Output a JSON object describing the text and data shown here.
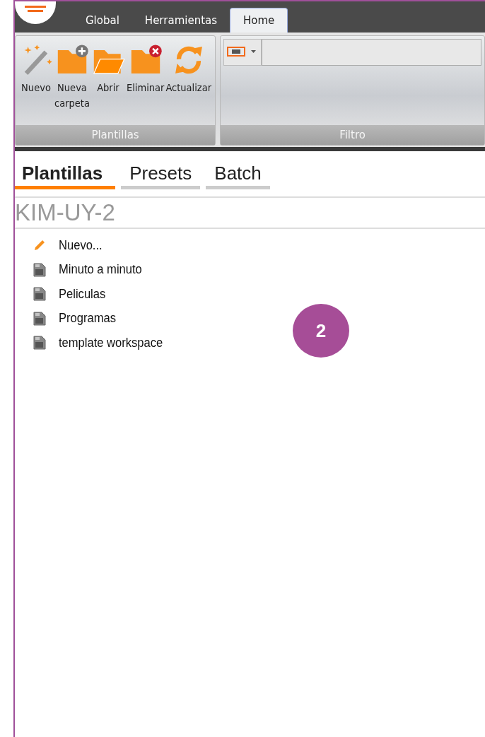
{
  "ribbon_tabs": [
    {
      "label": "Global",
      "selected": false
    },
    {
      "label": "Herramientas",
      "selected": false
    },
    {
      "label": "Home",
      "selected": true
    }
  ],
  "ribbon_groups": [
    {
      "label": "Plantillas",
      "kind": "buttons",
      "buttons": [
        {
          "label": "Nuevo",
          "kind": "wand"
        },
        {
          "label": "Nueva carpeta",
          "kind": "folder-add"
        },
        {
          "label": "Abrir",
          "kind": "folder-open"
        },
        {
          "label": "Eliminar",
          "kind": "folder-delete"
        },
        {
          "label": "Actualizar",
          "kind": "refresh"
        }
      ]
    },
    {
      "label": "Filtro",
      "kind": "filter"
    }
  ],
  "tabs": [
    {
      "label": "Plantillas",
      "selected": true
    },
    {
      "label": "Presets",
      "selected": false
    },
    {
      "label": "Batch",
      "selected": false
    }
  ],
  "section_title": "KIM-UY-2",
  "items": [
    {
      "label": "Nuevo...",
      "kind": "new"
    },
    {
      "label": "Minuto a minuto",
      "kind": "template"
    },
    {
      "label": "Peliculas",
      "kind": "template"
    },
    {
      "label": "Programas",
      "kind": "template"
    },
    {
      "label": "template workspace",
      "kind": "template"
    }
  ],
  "callout": "2"
}
